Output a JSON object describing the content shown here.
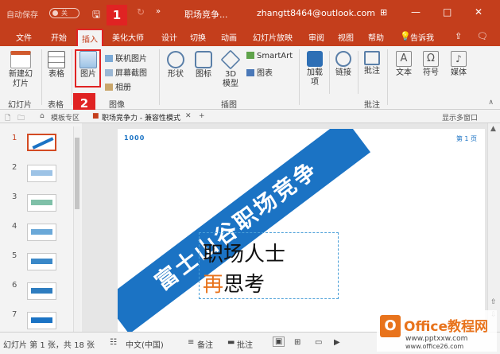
{
  "titlebar": {
    "autosave": "自动保存",
    "toggle": "关",
    "title": "职场竞争...",
    "user": "zhangtt8464@outlook.com"
  },
  "callouts": {
    "first": "1",
    "second": "2"
  },
  "tabs": [
    {
      "label": "文件"
    },
    {
      "label": "开始"
    },
    {
      "label": "插入",
      "active": true
    },
    {
      "label": "美化大师"
    },
    {
      "label": "设计"
    },
    {
      "label": "切换"
    },
    {
      "label": "动画"
    },
    {
      "label": "幻灯片放映"
    },
    {
      "label": "审阅"
    },
    {
      "label": "视图"
    },
    {
      "label": "帮助"
    },
    {
      "label": "告诉我"
    }
  ],
  "ribbon": {
    "new_slide": "新建幻灯片",
    "table": "表格",
    "picture": "图片",
    "online_picture": "联机图片",
    "screenshot": "屏幕截图",
    "album": "相册",
    "shapes": "形状",
    "icons": "图标",
    "model3d": "3D模型",
    "smartart": "SmartArt",
    "chart": "图表",
    "addins": "加载项",
    "link": "链接",
    "comment": "批注",
    "text": "文本",
    "symbol": "符号",
    "media": "媒体",
    "groups": {
      "slides": "幻灯片",
      "tables": "表格",
      "images": "图像",
      "illustrations": "插图",
      "comments": "批注"
    }
  },
  "doctabs": {
    "template": "模板专区",
    "document": "职场竞争力 - 兼容性模式",
    "show_multi": "显示多窗口"
  },
  "thumbnails": [
    "1",
    "2",
    "3",
    "4",
    "5",
    "6",
    "7"
  ],
  "slide": {
    "logo": "1000",
    "page": "第 1 页",
    "banner": "富士山谷职场竞争",
    "line1": "职场人士",
    "accent": "再",
    "line2_rest": "思考"
  },
  "status": {
    "slide_info": "幻灯片 第 1 张，共 18 张",
    "language": "中文(中国)",
    "notes": "备注",
    "comments": "批注"
  },
  "watermark": {
    "brand": "Office教程网",
    "url": "www.pptxxw.com",
    "site": "www.office26.com"
  },
  "colors": {
    "accent": "#c43e1c",
    "highlight": "#e02323",
    "banner": "#1b73c4"
  }
}
